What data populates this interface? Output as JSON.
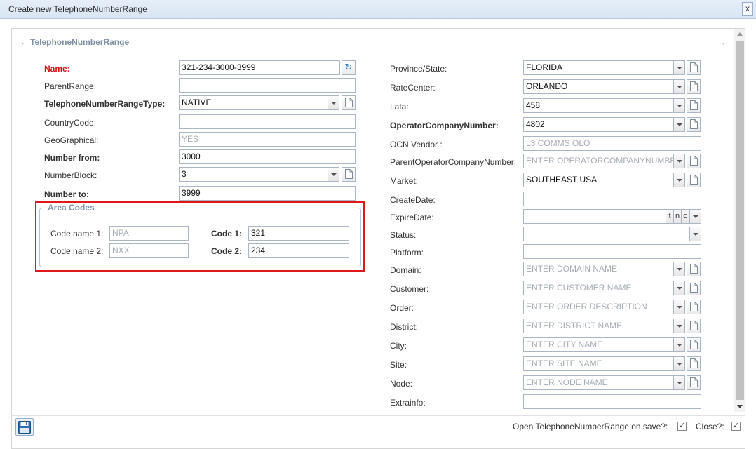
{
  "window": {
    "title": "Create new TelephoneNumberRange",
    "close_label": "x"
  },
  "fieldset": {
    "legend": "TelephoneNumberRange"
  },
  "left": {
    "name_label": "Name:",
    "name_value": "321-234-3000-3999",
    "parent_label": "ParentRange:",
    "parent_value": "",
    "type_label": "TelephoneNumberRangeType:",
    "type_value": "NATIVE",
    "country_label": "CountryCode:",
    "country_value": "",
    "geo_label": "GeoGraphical:",
    "geo_value": "YES",
    "from_label": "Number from:",
    "from_value": "3000",
    "block_label": "NumberBlock:",
    "block_value": "3",
    "to_label": "Number to:",
    "to_value": "3999"
  },
  "area_codes": {
    "legend": "Area Codes",
    "code_name_1_label": "Code name 1:",
    "code_name_1_value": "NPA",
    "code_name_2_label": "Code name 2:",
    "code_name_2_value": "NXX",
    "code_1_label": "Code 1:",
    "code_1_value": "321",
    "code_2_label": "Code 2:",
    "code_2_value": "234"
  },
  "right": {
    "province_label": "Province/State:",
    "province_value": "FLORIDA",
    "ratecenter_label": "RateCenter:",
    "ratecenter_value": "ORLANDO",
    "lata_label": "Lata:",
    "lata_value": "458",
    "ocn_label": "OperatorCompanyNumber:",
    "ocn_value": "4802",
    "ocn_vendor_label": "OCN Vendor :",
    "ocn_vendor_value": "L3 COMMS OLO",
    "parent_ocn_label": "ParentOperatorCompanyNumber:",
    "parent_ocn_placeholder": "ENTER OPERATORCOMPANYNUMBER",
    "market_label": "Market:",
    "market_value": "SOUTHEAST USA",
    "createdate_label": "CreateDate:",
    "createdate_value": "",
    "expiredate_label": "ExpireDate:",
    "expiredate_value": "",
    "expire_btn_t": "t",
    "expire_btn_n": "n",
    "expire_btn_c": "c",
    "status_label": "Status:",
    "status_value": "",
    "platform_label": "Platform:",
    "platform_value": "",
    "domain_label": "Domain:",
    "domain_placeholder": "ENTER DOMAIN NAME",
    "customer_label": "Customer:",
    "customer_placeholder": "ENTER CUSTOMER NAME",
    "order_label": "Order:",
    "order_placeholder": "ENTER ORDER DESCRIPTION",
    "district_label": "District:",
    "district_placeholder": "ENTER DISTRICT NAME",
    "city_label": "City:",
    "city_placeholder": "ENTER CITY NAME",
    "site_label": "Site:",
    "site_placeholder": "ENTER SITE NAME",
    "node_label": "Node:",
    "node_placeholder": "ENTER NODE NAME",
    "extrainfo_label": "Extrainfo:",
    "extrainfo_value": ""
  },
  "footer": {
    "open_label": "Open TelephoneNumberRange on save?:",
    "open_checked": "✓",
    "close_label": "Close?:",
    "close_checked": "✓"
  },
  "icons": {
    "refresh": "refresh-icon",
    "page": "page-icon",
    "save": "save-disk-icon",
    "dropdown": "chevron-down-icon"
  },
  "colors": {
    "required_label": "#d01010",
    "legend": "#7f8fa4",
    "highlight": "#e01818",
    "accent": "#2a78c8"
  }
}
